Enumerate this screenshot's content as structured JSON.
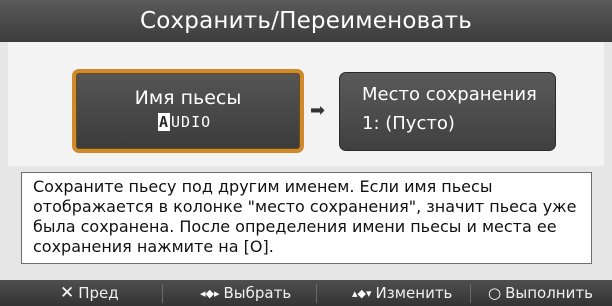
{
  "dialog": {
    "title": "Сохранить/Переименовать"
  },
  "name_field": {
    "label": "Имя пьесы",
    "cursor_char": "A",
    "rest_value": "UDIO"
  },
  "destination": {
    "label": "Место сохранения",
    "value": "1: (Пусто)"
  },
  "arrow_icon": "right-arrow",
  "description": "Сохраните пьесу под другим именем. Если имя пьесы отображается в колонке \"место сохранения\", значит пьеса уже была сохранена. После определения имени пьесы и места ее сохранения нажмите на [O].",
  "footer": {
    "prev_label": "Пред",
    "select_label": "Выбрать",
    "change_label": "Изменить",
    "execute_label": "Выполнить"
  },
  "colors": {
    "accent_border": "#d08a2c",
    "title_bg": "#4a4a4a"
  }
}
